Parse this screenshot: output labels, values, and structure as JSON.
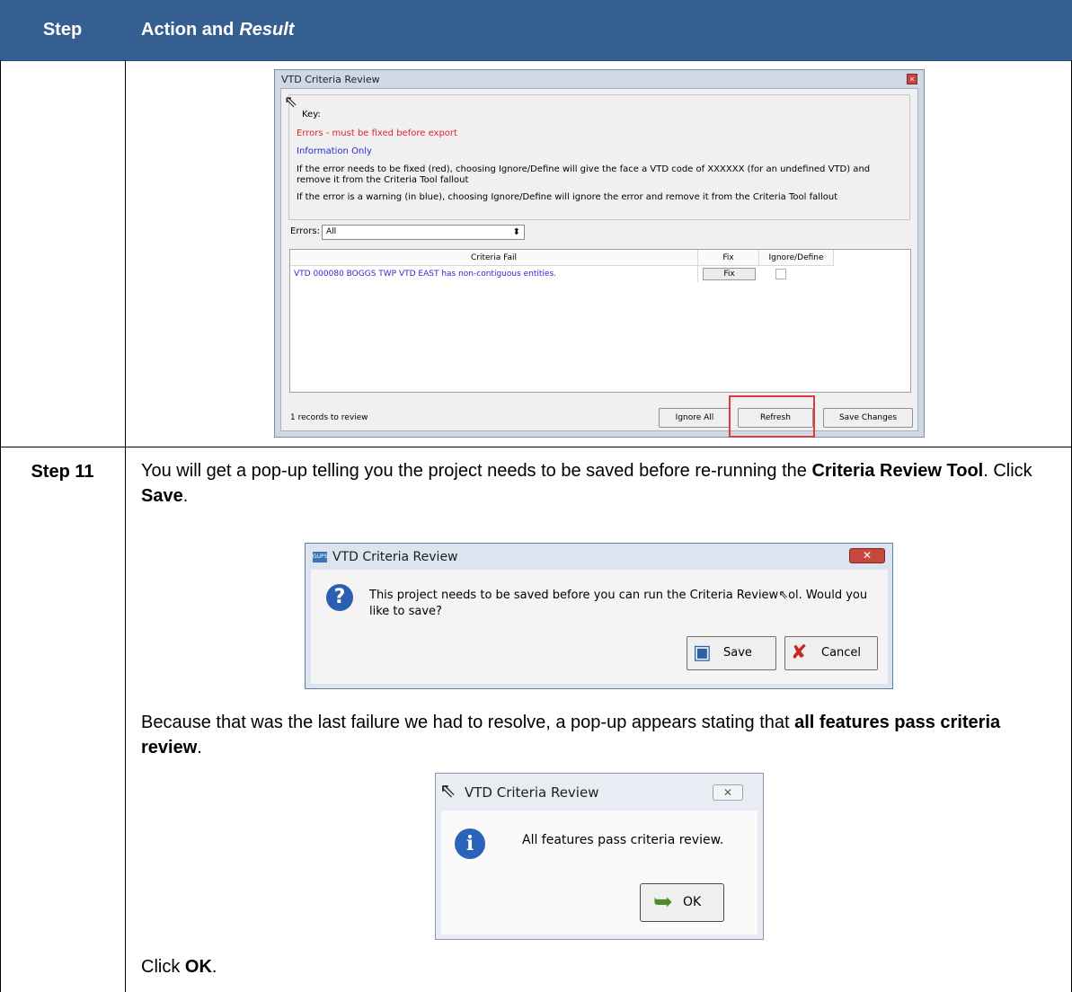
{
  "header": {
    "col_step": "Step",
    "col_action": "Action and",
    "col_action_italic": "Result"
  },
  "dialog1": {
    "title": "VTD Criteria Review",
    "key_label": "Key:",
    "key_errors": "Errors - must be fixed before export",
    "key_info": "Information Only",
    "key_line1": "If the error needs to be fixed (red), choosing Ignore/Define will give the face a VTD code of XXXXXX (for an undefined VTD) and remove it from the Criteria Tool fallout",
    "key_line2": "If the error is a warning (in blue), choosing Ignore/Define will ignore the error and remove it from the Criteria Tool fallout",
    "errors_label": "Errors:",
    "errors_value": "All",
    "col_criteria": "Criteria Fail",
    "col_fix": "Fix",
    "col_ignore": "Ignore/Define",
    "row_text": "VTD 000080 BOGGS TWP VTD EAST has non-contiguous entities.",
    "row_fix": "Fix",
    "records": "1 records to review",
    "btn_ignore_all": "Ignore All",
    "btn_refresh": "Refresh",
    "btn_save_changes": "Save Changes",
    "colors": {
      "error": "#e3242b",
      "info": "#2a2ad2",
      "highlight": "#e0393e"
    }
  },
  "step11": {
    "label": "Step 11",
    "p1_a": "You will get a pop-up telling you the project needs to be saved before re-running the ",
    "p1_b": "Criteria Review Tool",
    "p1_c": ". Click ",
    "p1_d": "Save",
    "p1_e": ".",
    "p2_a": "Because that was the last failure we had to resolve, a pop-up appears stating that ",
    "p2_b": "all features pass criteria review",
    "p2_c": ".",
    "p3_a": "Click ",
    "p3_b": "OK",
    "p3_c": "."
  },
  "dialog2": {
    "title": "VTD Criteria Review",
    "app_icon": "GUPS",
    "message_a": "This project needs to be saved before you can run the Criteria Review",
    "message_b": "ol. Would you like to save?",
    "btn_save": "Save",
    "btn_cancel": "Cancel"
  },
  "dialog3": {
    "title": "VTD Criteria Review",
    "message": "All features pass criteria review.",
    "btn_ok": "OK"
  }
}
